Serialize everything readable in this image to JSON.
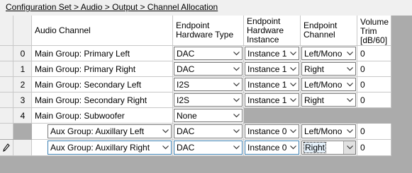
{
  "breadcrumb": "Configuration Set > Audio > Output > Channel Allocation",
  "columns": {
    "audio_channel": "Audio Channel",
    "hw_type": "Endpoint Hardware Type",
    "hw_instance": "Endpoint Hardware Instance",
    "channel": "Endpoint Channel",
    "volume": "Volume Trim [dB/60]"
  },
  "rows": [
    {
      "num": "0",
      "audio_channel": "Main Group: Primary Left",
      "hw_type": "DAC",
      "hw_instance": "Instance 1",
      "channel": "Left/Mono",
      "volume": "0"
    },
    {
      "num": "1",
      "audio_channel": "Main Group: Primary Right",
      "hw_type": "DAC",
      "hw_instance": "Instance 1",
      "channel": "Right",
      "volume": "0"
    },
    {
      "num": "2",
      "audio_channel": "Main Group: Secondary Left",
      "hw_type": "I2S",
      "hw_instance": "Instance 1",
      "channel": "Left/Mono",
      "volume": "0"
    },
    {
      "num": "3",
      "audio_channel": "Main Group: Secondary Right",
      "hw_type": "I2S",
      "hw_instance": "Instance 1",
      "channel": "Right",
      "volume": "0"
    },
    {
      "num": "4",
      "audio_channel": "Main Group: Subwoofer",
      "hw_type": "None"
    },
    {
      "audio_channel": "Aux Group: Auxillary Left",
      "hw_type": "DAC",
      "hw_instance": "Instance 0",
      "channel": "Left/Mono",
      "volume": "0"
    },
    {
      "audio_channel": "Aux Group: Auxillary Right",
      "hw_type": "DAC",
      "hw_instance": "Instance 0",
      "channel": "Right",
      "volume": "0"
    }
  ]
}
